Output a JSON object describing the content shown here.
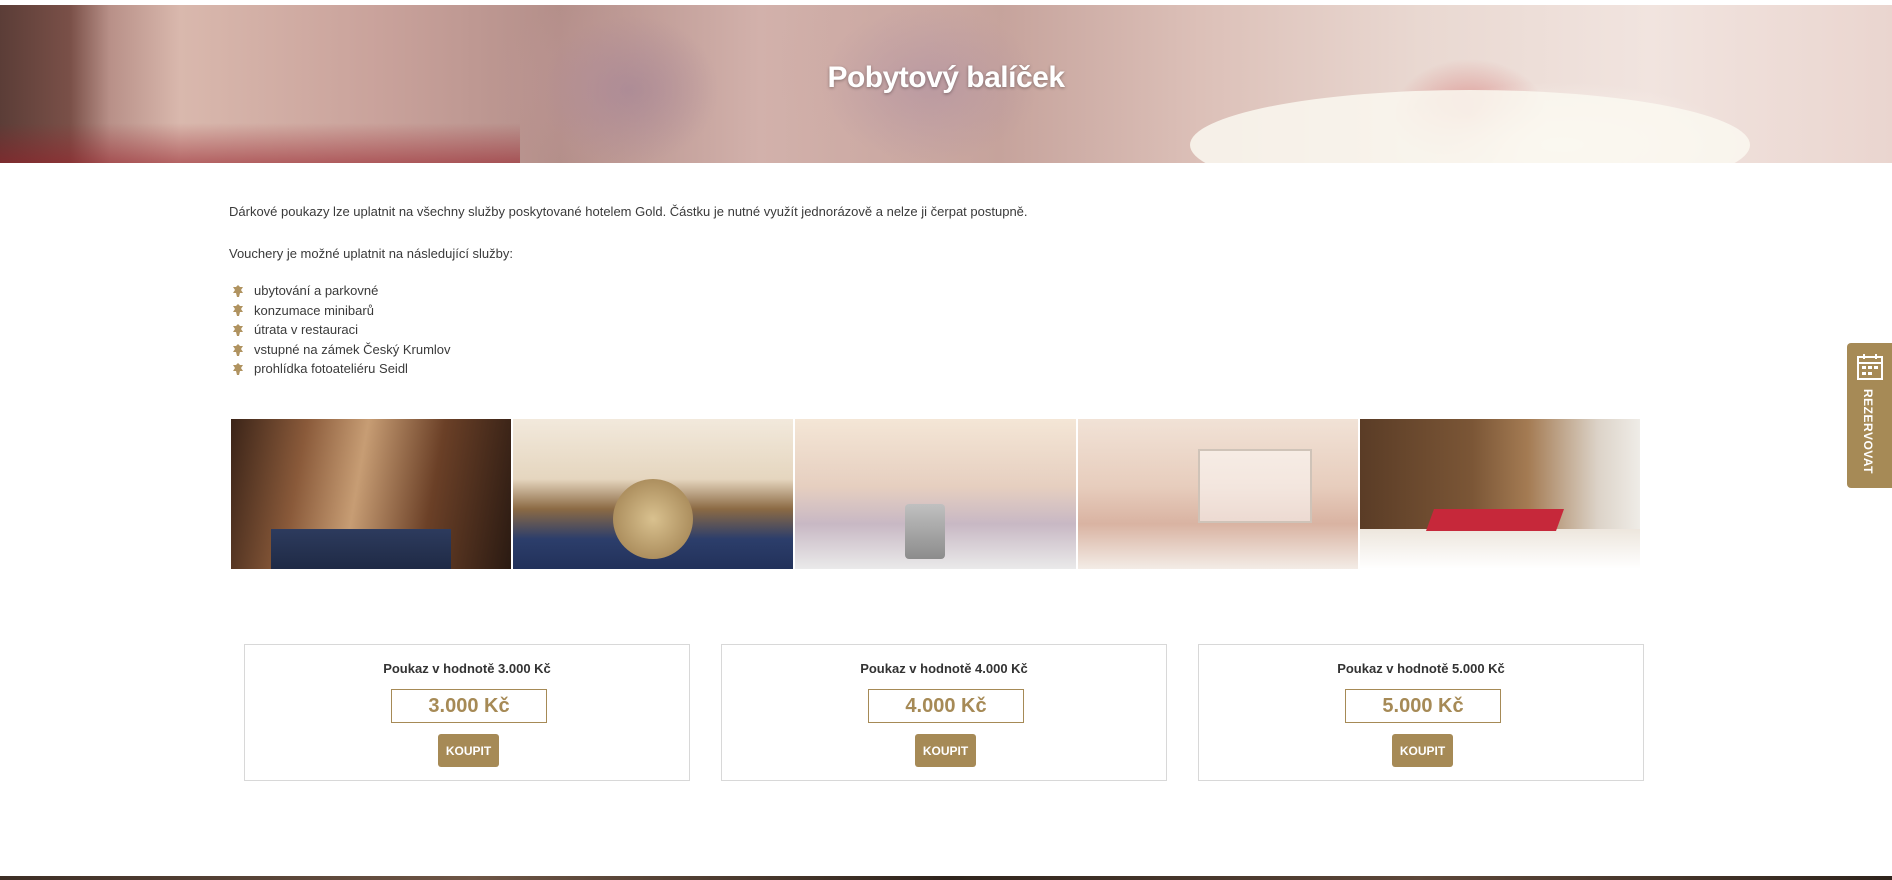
{
  "hero": {
    "title": "Pobytový balíček"
  },
  "intro": {
    "paragraph1": "Dárkové poukazy lze uplatnit na všechny služby poskytované hotelem Gold. Částku je nutné využít jednorázově a nelze ji čerpat postupně.",
    "paragraph2": "Vouchery je možné uplatnit na následující služby:"
  },
  "services": [
    "ubytování a parkovné",
    "konzumace minibarů",
    "útrata v restauraci",
    "vstupné na zámek Český Krumlov",
    "prohlídka fotoateliéru Seidl"
  ],
  "gallery": {
    "photos": [
      "hotel-staircase",
      "hotel-room-table",
      "hotel-suite-living-room",
      "hotel-bathroom",
      "breakfast-tray-in-bed"
    ]
  },
  "vouchers": [
    {
      "title": "Poukaz v hodnotě 3.000 Kč",
      "price": "3.000 Kč",
      "button": "KOUPIT"
    },
    {
      "title": "Poukaz v hodnotě 4.000 Kč",
      "price": "4.000 Kč",
      "button": "KOUPIT"
    },
    {
      "title": "Poukaz v hodnotě 5.000 Kč",
      "price": "5.000 Kč",
      "button": "KOUPIT"
    }
  ],
  "reserve_tab": {
    "label": "REZERVOVAT",
    "icon": "calendar-icon"
  },
  "colors": {
    "accent": "#a68a56",
    "text": "#3a3a3a",
    "card_border": "#d8d8d8"
  }
}
